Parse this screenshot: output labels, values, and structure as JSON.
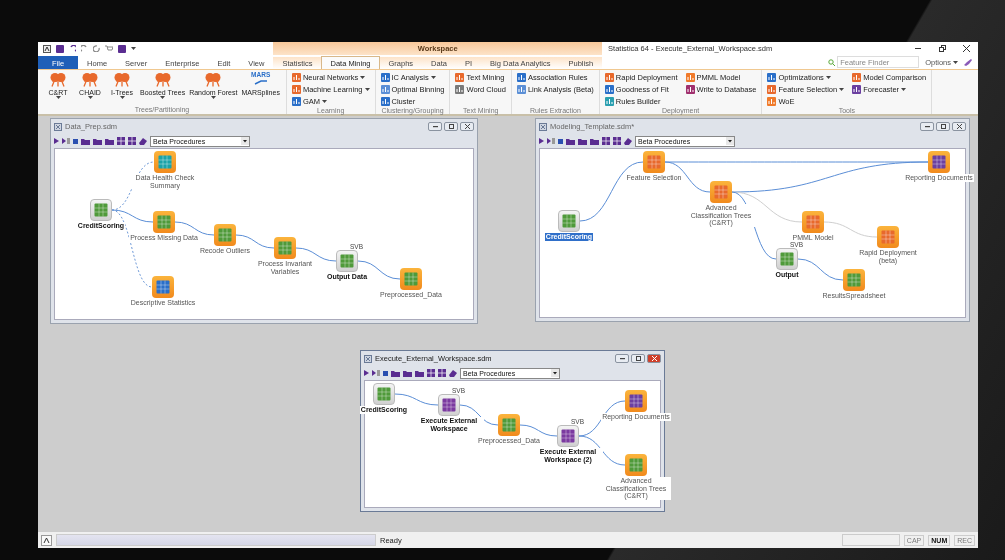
{
  "context_group": {
    "label": "Workspace"
  },
  "window_title": "Statistica 64 - Execute_External_Workspace.sdm",
  "tabs": [
    {
      "label": "File",
      "kind": "file",
      "selected": false,
      "context": false
    },
    {
      "label": "Home",
      "kind": "tab",
      "selected": false,
      "context": false
    },
    {
      "label": "Server",
      "kind": "tab",
      "selected": false,
      "context": false
    },
    {
      "label": "Enterprise",
      "kind": "tab",
      "selected": false,
      "context": false
    },
    {
      "label": "Edit",
      "kind": "tab",
      "selected": false,
      "context": false
    },
    {
      "label": "View",
      "kind": "tab",
      "selected": false,
      "context": false
    },
    {
      "label": "Statistics",
      "kind": "tab",
      "selected": false,
      "context": true
    },
    {
      "label": "Data Mining",
      "kind": "tab",
      "selected": true,
      "context": true
    },
    {
      "label": "Graphs",
      "kind": "tab",
      "selected": false,
      "context": true
    },
    {
      "label": "Data",
      "kind": "tab",
      "selected": false,
      "context": true
    },
    {
      "label": "PI",
      "kind": "tab",
      "selected": false,
      "context": true
    },
    {
      "label": "Big Data Analytics",
      "kind": "tab",
      "selected": false,
      "context": true
    },
    {
      "label": "Publish",
      "kind": "tab",
      "selected": false,
      "context": true
    }
  ],
  "feature_finder": {
    "placeholder": "Feature Finder"
  },
  "options_menu": {
    "label": "Options"
  },
  "ribbon_groups": [
    {
      "title": "Trees/Partitioning",
      "kind": "large",
      "items": [
        {
          "label": "C&RT",
          "color": "#e8692c",
          "dropdown": true
        },
        {
          "label": "CHAID",
          "color": "#e8692c",
          "dropdown": true
        },
        {
          "label": "I-Trees",
          "color": "#e8692c",
          "dropdown": true
        },
        {
          "label": "Boosted Trees",
          "color": "#e8692c",
          "dropdown": true
        },
        {
          "label": "Random Forest",
          "color": "#e8692c",
          "dropdown": true
        },
        {
          "label": "MARSplines",
          "color": "#2a6fc9",
          "dropdown": false,
          "badge": "MARS"
        }
      ]
    },
    {
      "title": "Learning",
      "kind": "small",
      "items": [
        {
          "label": "Neural Networks",
          "color": "#e8692c",
          "dropdown": true
        },
        {
          "label": "Machine Learning",
          "color": "#e8692c",
          "dropdown": true
        },
        {
          "label": "GAM",
          "color": "#2a6fc9",
          "dropdown": true
        }
      ]
    },
    {
      "title": "Clustering/Grouping",
      "kind": "small",
      "items": [
        {
          "label": "IC Analysis",
          "color": "#2a6fc9",
          "dropdown": true
        },
        {
          "label": "Optimal Binning",
          "color": "#5b8fd6",
          "dropdown": false
        },
        {
          "label": "Cluster",
          "color": "#2a6fc9",
          "dropdown": false
        }
      ]
    },
    {
      "title": "Text Mining",
      "kind": "small",
      "items": [
        {
          "label": "Text Mining",
          "color": "#e8692c",
          "dropdown": false
        },
        {
          "label": "Word Cloud",
          "color": "#7a7a7a",
          "dropdown": false
        }
      ]
    },
    {
      "title": "Rules Extraction",
      "kind": "small",
      "items": [
        {
          "label": "Association Rules",
          "color": "#2a6fc9",
          "dropdown": false
        },
        {
          "label": "Link Analysis (Beta)",
          "color": "#5b8fd6",
          "dropdown": false
        }
      ]
    },
    {
      "title": "Deployment",
      "kind": "small",
      "items": [
        {
          "label": "Rapid Deployment",
          "color": "#e8692c",
          "dropdown": false
        },
        {
          "label": "Goodness of Fit",
          "color": "#2a6fc9",
          "dropdown": false
        },
        {
          "label": "Rules Builder",
          "color": "#2a9fb0",
          "dropdown": false
        },
        {
          "label": "PMML Model",
          "color": "#f07a2a",
          "dropdown": false
        },
        {
          "label": "Write to Database",
          "color": "#a0306e",
          "dropdown": false
        }
      ]
    },
    {
      "title": "Tools",
      "kind": "small",
      "items": [
        {
          "label": "Optimizations",
          "color": "#2a6fc9",
          "dropdown": true
        },
        {
          "label": "Feature Selection",
          "color": "#e8692c",
          "dropdown": true
        },
        {
          "label": "WoE",
          "color": "#f07a2a",
          "dropdown": false
        },
        {
          "label": "Model Comparison",
          "color": "#e8692c",
          "dropdown": false
        },
        {
          "label": "Forecaster",
          "color": "#6b3fa0",
          "dropdown": true
        }
      ]
    }
  ],
  "documents": [
    {
      "title": "Data_Prep.sdm",
      "active": false,
      "procedure": "Beta Procedures",
      "nodes": [
        {
          "label": "CreditScoring",
          "kind": "source",
          "color": "#4f9a3a",
          "selected": false
        },
        {
          "label": "Data Health Check Summary",
          "kind": "node",
          "color": "#1aa3a8",
          "selected": false
        },
        {
          "label": "Process Missing Data",
          "kind": "node",
          "color": "#4f9a3a",
          "selected": false
        },
        {
          "label": "Recode Outliers",
          "kind": "node",
          "color": "#4f9a3a",
          "selected": false
        },
        {
          "label": "Process Invariant Variables",
          "kind": "node",
          "color": "#4f9a3a",
          "selected": false
        },
        {
          "label": "Output Data",
          "kind": "output",
          "color": "#4f9a3a",
          "selected": false,
          "badge": "SVB"
        },
        {
          "label": "Preprocessed_Data",
          "kind": "node",
          "color": "#4f9a3a",
          "selected": false
        },
        {
          "label": "Descriptive Statistics",
          "kind": "node",
          "color": "#2a6fc9",
          "selected": false
        }
      ]
    },
    {
      "title": "Modeling_Template.sdm*",
      "active": false,
      "procedure": "Beta Procedures",
      "nodes": [
        {
          "label": "Feature Selection",
          "kind": "node",
          "color": "#e8692c",
          "selected": false
        },
        {
          "label": "Reporting Documents",
          "kind": "node",
          "color": "#6b3fa0",
          "selected": false
        },
        {
          "label": "Advanced Classification Trees (C&RT)",
          "kind": "node",
          "color": "#e8692c",
          "selected": false
        },
        {
          "label": "CreditScoring",
          "kind": "source",
          "color": "#4f9a3a",
          "selected": true
        },
        {
          "label": "PMML Model",
          "kind": "node",
          "color": "#e8692c",
          "selected": false
        },
        {
          "label": "Output",
          "kind": "output",
          "color": "#4f9a3a",
          "selected": false,
          "badge": "SVB"
        },
        {
          "label": "Rapid Deployment (beta)",
          "kind": "node",
          "color": "#e8692c",
          "selected": false
        },
        {
          "label": "ResultsSpreadsheet",
          "kind": "node",
          "color": "#4f9a3a",
          "selected": false
        }
      ]
    },
    {
      "title": "Execute_External_Workspace.sdm",
      "active": true,
      "procedure": "Beta Procedures",
      "nodes": [
        {
          "label": "CreditScoring",
          "kind": "source",
          "color": "#4f9a3a",
          "selected": false
        },
        {
          "label": "Execute External Workspace",
          "kind": "output",
          "color": "#7b3aa0",
          "selected": false,
          "badge": "SVB"
        },
        {
          "label": "Reporting Documents",
          "kind": "node",
          "color": "#6b3fa0",
          "selected": false
        },
        {
          "label": "Preprocessed_Data",
          "kind": "node",
          "color": "#4f9a3a",
          "selected": false
        },
        {
          "label": "Execute External Workspace (2)",
          "kind": "output",
          "color": "#7b3aa0",
          "selected": false,
          "badge": "SVB"
        },
        {
          "label": "Advanced Classification Trees (C&RT)",
          "kind": "node",
          "color": "#4f9a3a",
          "selected": false
        }
      ]
    }
  ],
  "status_bar": {
    "message": "Ready",
    "indicators": [
      {
        "label": "CAP",
        "on": false
      },
      {
        "label": "NUM",
        "on": true
      },
      {
        "label": "REC",
        "on": false
      }
    ]
  }
}
